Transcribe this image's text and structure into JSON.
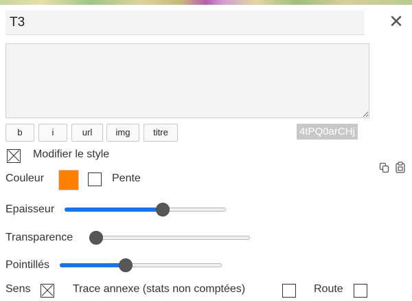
{
  "title_value": "T3",
  "close_glyph": "✕",
  "description_value": "",
  "format_buttons": [
    "b",
    "i",
    "url",
    "img",
    "titre"
  ],
  "trace_id": "4tPQ0arCHj",
  "modify_style": {
    "label": "Modifier le style",
    "checked": true
  },
  "couleur": {
    "label": "Couleur",
    "value": "#ff8000"
  },
  "pente": {
    "label": "Pente",
    "checked": false
  },
  "sliders": {
    "epaisseur": {
      "label": "Epaisseur",
      "fraction": 0.62
    },
    "transparence": {
      "label": "Transparence",
      "fraction": 0.0
    },
    "pointilles": {
      "label": "Pointillés",
      "fraction": 0.4
    }
  },
  "sens": {
    "label": "Sens",
    "checked": true
  },
  "trace_annexe": {
    "label": "Trace annexe (stats non comptées)",
    "checked": false
  },
  "route": {
    "label": "Route",
    "checked": false
  },
  "colors": {
    "slider_fill": "#1a73e8",
    "thumb": "#575757",
    "badge_bg": "#c8c8c8"
  }
}
